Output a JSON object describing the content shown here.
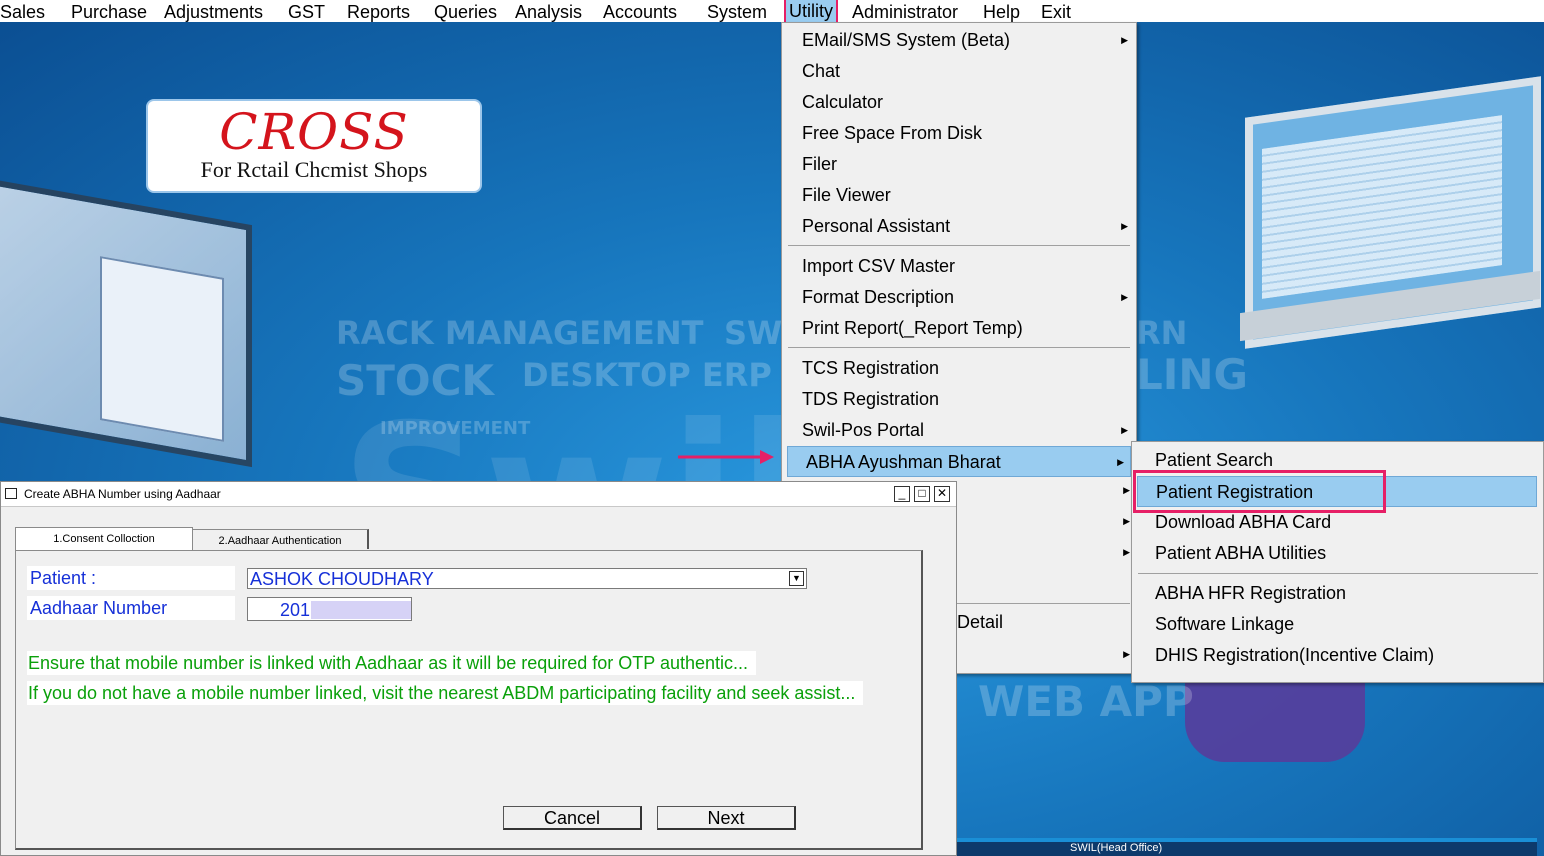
{
  "menubar": {
    "items": [
      "Sales",
      "Purchase",
      "Adjustments",
      "GST",
      "Reports",
      "Queries",
      "Analysis",
      "Accounts",
      "System",
      "Utility",
      "Administrator",
      "Help",
      "Exit"
    ]
  },
  "logo": {
    "title": "CROSS",
    "subtitle": "For Rctail Chcmist Shops"
  },
  "background_text": {
    "rack": "RACK MANAGEMENT",
    "sw": "SW",
    "stock": "STOCK",
    "desktop": "DESKTOP ERP",
    "rn": "RN",
    "ling": "LING",
    "improvement": "IMPROVEMENT",
    "swil": "Swil",
    "webapp": "WEB APP",
    "status_office": "SWIL(Head Office)"
  },
  "utility_menu": {
    "items": [
      {
        "label": "EMail/SMS System (Beta)",
        "submenu": true
      },
      {
        "label": "Chat",
        "submenu": false
      },
      {
        "label": "Calculator",
        "submenu": false
      },
      {
        "label": "Free Space From Disk",
        "submenu": false
      },
      {
        "label": "Filer",
        "submenu": false
      },
      {
        "label": "File Viewer",
        "submenu": false
      },
      {
        "label": "Personal Assistant",
        "submenu": true
      },
      {
        "label": "Import CSV Master",
        "submenu": false
      },
      {
        "label": "Format Description",
        "submenu": true
      },
      {
        "label": "Print Report(_Report Temp)",
        "submenu": false
      },
      {
        "label": "TCS Registration",
        "submenu": false
      },
      {
        "label": "TDS Registration",
        "submenu": false
      },
      {
        "label": "Swil-Pos Portal",
        "submenu": true
      },
      {
        "label": "ABHA Ayushman Bharat",
        "submenu": true,
        "highlighted": true
      }
    ],
    "obscured_item_label": "Detail"
  },
  "abha_submenu": {
    "items": [
      {
        "label": "Patient Search"
      },
      {
        "label": "Patient Registration",
        "highlighted": true
      },
      {
        "label": "Download ABHA Card"
      },
      {
        "label": "Patient ABHA Utilities"
      },
      {
        "label": "ABHA HFR Registration"
      },
      {
        "label": "Software Linkage"
      },
      {
        "label": "DHIS Registration(Incentive Claim)"
      }
    ]
  },
  "dialog": {
    "title": "Create ABHA Number using Aadhaar",
    "tabs": [
      "1.Consent Colloction",
      "2.Aadhaar Authentication"
    ],
    "patient_label": "Patient :",
    "patient_value": "ASHOK CHOUDHARY",
    "aadhaar_label": "Aadhaar Number",
    "aadhaar_value": "201",
    "note1": "Ensure that mobile number is linked with Aadhaar as it will be required for OTP authentic...",
    "note2": "If you do not have a mobile number linked, visit the nearest ABDM participating facility and seek assist...",
    "cancel_label": "Cancel",
    "next_label": "Next"
  },
  "colors": {
    "highlight": "#99ccf0",
    "marker": "#e61f66",
    "label_blue": "#1630d8",
    "note_green": "#0aa00a"
  }
}
